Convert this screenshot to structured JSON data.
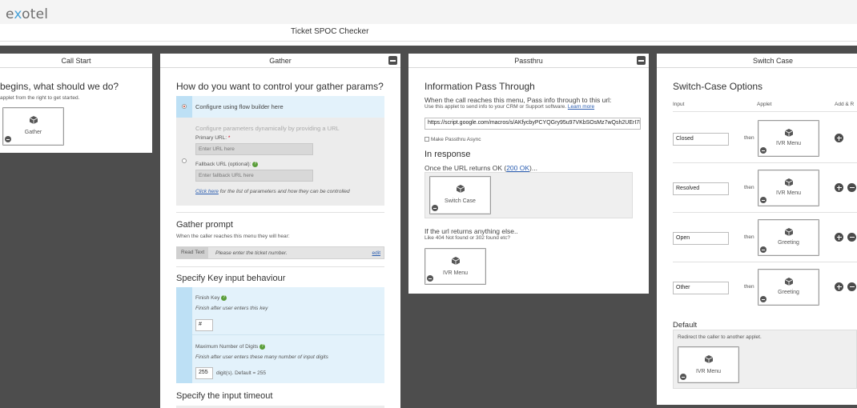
{
  "app": {
    "logo_text_a": "e",
    "logo_text_x": "x",
    "logo_text_b": "otel"
  },
  "flow": {
    "title": "Ticket SPOC Checker"
  },
  "call_start": {
    "header": "Call Start",
    "heading": "begins, what should we do?",
    "hint": "applet from the right to get started.",
    "applet_label": "Gather"
  },
  "gather": {
    "header": "Gather",
    "heading": "How do you want to control your gather params?",
    "option_builder": "Configure using flow builder here",
    "option_url": "Configure parameters dynamically by providing a URL",
    "primary_url_label": "Primary URL:",
    "primary_url_required": "*",
    "primary_url_placeholder": "Enter URL here",
    "fallback_url_label": "Fallback URL (optional):",
    "fallback_url_placeholder": "Enter fallback URL here",
    "click_here": "Click here",
    "click_here_rest": " for the list of parameters and how they can be controlled",
    "prompt_heading": "Gather prompt",
    "prompt_hint": "When the caller reaches this menu they will hear:",
    "read_text_label": "Read Text",
    "prompt_text": "Please enter the ticket number.",
    "edit_link": "edit",
    "key_heading": "Specify Key input behaviour",
    "finish_key_label": "Finish Key",
    "finish_key_hint": "Finish after user enters this key",
    "finish_key_value": "#",
    "max_digits_label": "Maximum Number of Digits",
    "max_digits_hint": "Finish after user enters these many number of input digits",
    "max_digits_value": "255",
    "max_digits_suffix": "digit(s). Default = 255",
    "timeout_heading": "Specify the input timeout",
    "help_glyph": "?"
  },
  "passthru": {
    "header": "Passthru",
    "heading": "Information Pass Through",
    "desc": "When the call reaches this menu, Pass info through to this url:",
    "sub_desc": "Use this applet to send info to your CRM or Support software.",
    "learn_more": "Learn more",
    "url_value": "https://script.google.com/macros/s/AKfycbyPCYQGry95u97VKbSOsMz7wQsh2UErI7E",
    "make_async": "Make Passthru Async",
    "response_heading": "In response",
    "ok_text_a": "Once the URL returns OK (",
    "ok_link": "200 OK",
    "ok_text_b": ")...",
    "ok_applet": "Switch Case",
    "else_text": "If the url returns anything else..",
    "else_hint": "Like 404 Not found or 302 found etc?",
    "else_applet": "IVR Menu"
  },
  "switch_case": {
    "header": "Switch Case",
    "heading": "Switch-Case Options",
    "col_input": "Input",
    "col_applet": "Applet",
    "col_add": "Add & R",
    "then_text": "then",
    "cases": [
      {
        "input": "Closed",
        "applet": "IVR Menu"
      },
      {
        "input": "Resolved",
        "applet": "IVR Menu"
      },
      {
        "input": "Open",
        "applet": "Greeting"
      },
      {
        "input": "Other",
        "applet": "Greeting"
      }
    ],
    "default_heading": "Default",
    "default_hint": "Redirect the caller to another applet.",
    "default_applet": "IVR Menu"
  }
}
